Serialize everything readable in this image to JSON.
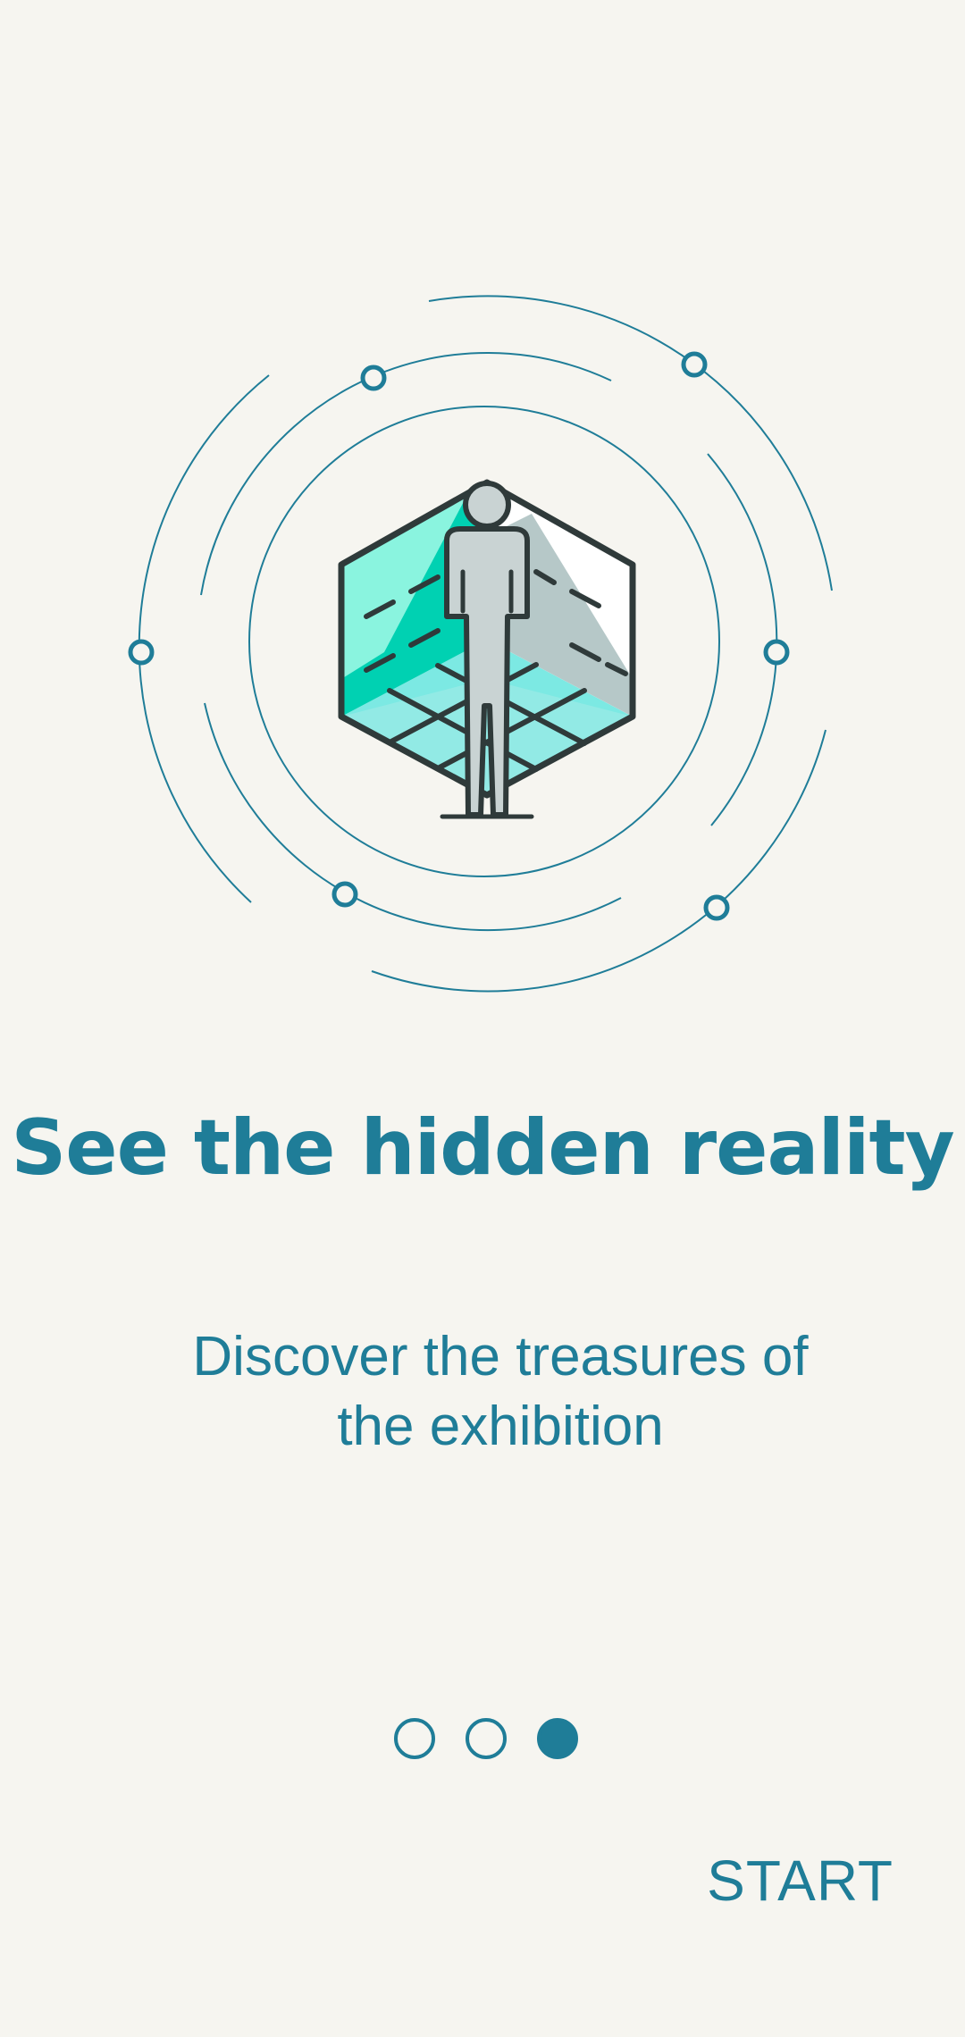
{
  "onboarding": {
    "title": "See the hidden reality",
    "subtitle": "Discover the treasures of the exhibition",
    "page_indicator": {
      "total": 3,
      "current": 3
    },
    "start_label": "START"
  },
  "colors": {
    "background": "#f6f5f0",
    "accent": "#1f7d98",
    "teal": "#00d1b2",
    "mint": "#7ff2dc",
    "grey": "#c9d3d3"
  },
  "icons": [
    "orbit-rings-illustration",
    "vr-room-person-icon"
  ]
}
